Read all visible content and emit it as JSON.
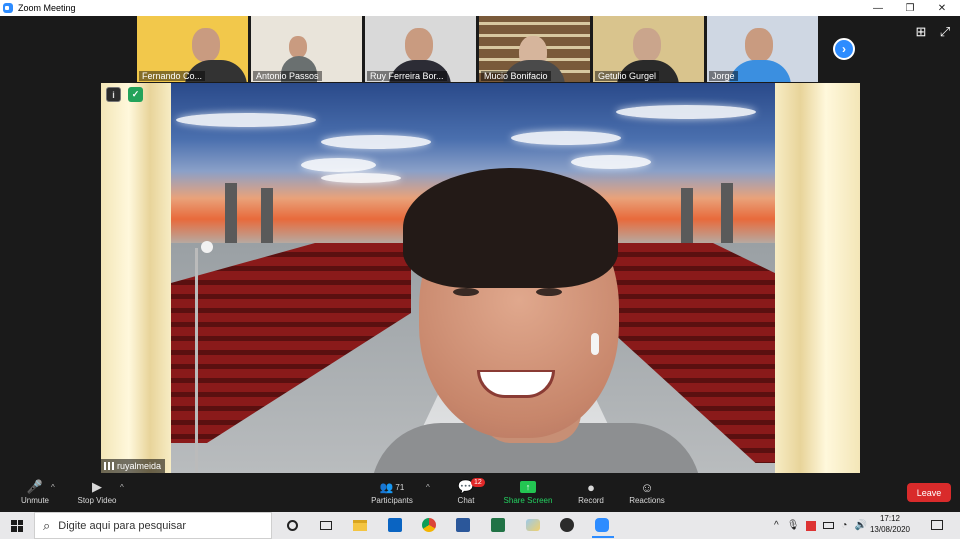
{
  "window": {
    "title": "Zoom Meeting",
    "minimize": "—",
    "restore": "❐",
    "close": "✕"
  },
  "participants_strip": [
    {
      "name": "Fernando Co...",
      "bg": "#f2c84b",
      "shirt": "#333333"
    },
    {
      "name": "Antonio Passos",
      "bg": "#e9e4da",
      "shirt": "#6a7070"
    },
    {
      "name": "Ruy Ferreira Bor...",
      "bg": "#d9d9d9",
      "shirt": "#2c2c35"
    },
    {
      "name": "Mucio Bonifacio",
      "bg": "#7a5a3a",
      "shirt": "#4a4a4a"
    },
    {
      "name": "Getulio Gurgel",
      "bg": "#d9c48d",
      "shirt": "#2a2a2a"
    },
    {
      "name": "Jorge",
      "bg": "#cfd7e3",
      "shirt": "#3b8fe0"
    }
  ],
  "strip_next": "›",
  "view_icons": {
    "gallery": "⊞",
    "fullscreen": "⤢"
  },
  "main_video": {
    "speaker_name": "ruyalmeida",
    "info_icon": "i",
    "shield_icon": "✓"
  },
  "controls": {
    "unmute": {
      "label": "Unmute",
      "icon": "🎤"
    },
    "stop_video": {
      "label": "Stop Video",
      "icon": "▶"
    },
    "participants": {
      "label": "Participants",
      "count": "71",
      "icon": "👥"
    },
    "chat": {
      "label": "Chat",
      "badge": "12",
      "icon": "💬"
    },
    "share_screen": {
      "label": "Share Screen",
      "icon": "↑"
    },
    "record": {
      "label": "Record",
      "icon": "●"
    },
    "reactions": {
      "label": "Reactions",
      "icon": "☺"
    },
    "leave": {
      "label": "Leave"
    },
    "caret": "^"
  },
  "taskbar": {
    "search_placeholder": "Digite aqui para pesquisar",
    "search_icon": "⌕",
    "time": "17:12",
    "date": "13/08/2020",
    "apps": [
      "cortana",
      "task-view",
      "file-explorer",
      "outlook",
      "chrome",
      "word",
      "excel",
      "paint",
      "obs",
      "zoom"
    ]
  }
}
